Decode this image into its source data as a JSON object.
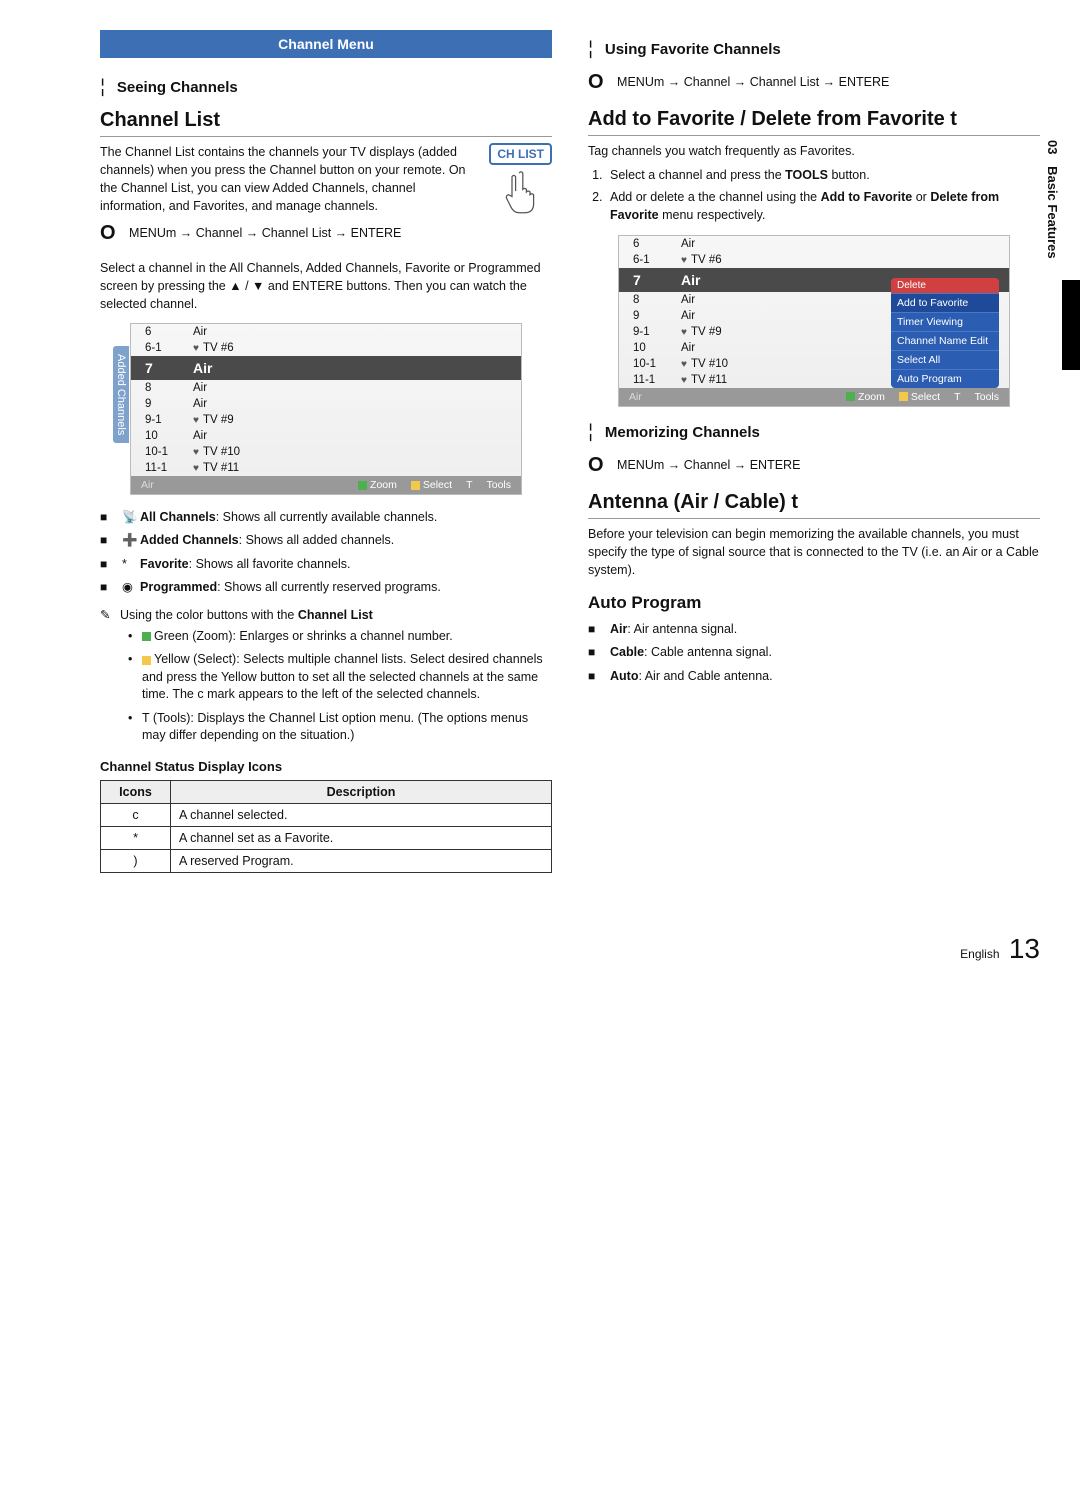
{
  "side": {
    "section_num": "03",
    "section_label": "Basic Features"
  },
  "left": {
    "header": "Channel Menu",
    "sub1_f": "¦",
    "sub1": "Seeing Channels",
    "h2": "Channel List",
    "chlist_label": "CH LIST",
    "intro": "The Channel List contains the channels your TV displays (added channels) when you press the Channel button on your remote. On the Channel List, you can view Added Channels, channel information, and Favorites, and manage channels.",
    "menu_O": "O",
    "menu_path": "MENUm  → Channel → Channel List → ENTERE",
    "select_text": "Select a channel in the All Channels, Added Channels, Favorite or Programmed screen by pressing the ▲ / ▼ and ENTERE  buttons. Then you can watch the selected channel.",
    "tv1": {
      "tab": "Added Channels",
      "rows": [
        {
          "ch": "6",
          "name": "Air",
          "heart": false
        },
        {
          "ch": "6-1",
          "name": "TV #6",
          "heart": true
        },
        {
          "ch": "7",
          "name": "Air",
          "sel": true
        },
        {
          "ch": "8",
          "name": "Air",
          "heart": false
        },
        {
          "ch": "9",
          "name": "Air",
          "heart": false
        },
        {
          "ch": "9-1",
          "name": "TV #9",
          "heart": true
        },
        {
          "ch": "10",
          "name": "Air",
          "heart": false
        },
        {
          "ch": "10-1",
          "name": "TV #10",
          "heart": true
        },
        {
          "ch": "11-1",
          "name": "TV #11",
          "heart": true
        }
      ],
      "footer_src": "Air",
      "footer_zoom": "Zoom",
      "footer_select": "Select",
      "footer_t": "T",
      "footer_tools": "Tools"
    },
    "bullets": [
      {
        "icon": "📡",
        "label": "All Channels",
        "desc": ": Shows all currently available channels."
      },
      {
        "icon": "➕",
        "label": "Added Channels",
        "desc": ": Shows all added channels."
      },
      {
        "icon": "*",
        "label": "Favorite",
        "desc": ": Shows all favorite channels."
      },
      {
        "icon": "◉",
        "label": "Programmed",
        "desc": ": Shows all currently reserved programs."
      }
    ],
    "note_pencil": "✎",
    "note": "Using the color buttons with the Channel List",
    "dots": [
      {
        "sq": "g",
        "label": "Green (Zoom)",
        "desc": ": Enlarges or shrinks a channel number."
      },
      {
        "sq": "y",
        "label": "Yellow (Select)",
        "desc": ": Selects multiple channel lists. Select desired channels and press the Yellow button to set all the selected channels at the same time. The c  mark appears to the left of the selected channels."
      },
      {
        "sq": "",
        "label": "T  (Tools)",
        "desc": ": Displays the Channel List option menu. (The options menus may differ depending on the situation.)"
      }
    ],
    "status_heading": "Channel Status Display Icons",
    "status_th_icons": "Icons",
    "status_th_desc": "Description",
    "status_rows": [
      {
        "icon": "c",
        "desc": "A channel selected."
      },
      {
        "icon": "*",
        "desc": "A channel set as a Favorite."
      },
      {
        "icon": ")",
        "desc": "A reserved Program."
      }
    ]
  },
  "right": {
    "sub1_f": "¦",
    "sub1": "Using Favorite Channels",
    "menu_O": "O",
    "menu_path1": "MENUm  → Channel → Channel List → ENTERE",
    "h2": "Add to Favorite / Delete from Favorite t",
    "tag_intro": "Tag channels you watch frequently as Favorites.",
    "steps": [
      "Select a channel and press the TOOLS button.",
      "Add or delete a the channel using the Add to Favorite or Delete from Favorite menu respectively."
    ],
    "tv2": {
      "rows": [
        {
          "ch": "6",
          "name": "Air",
          "heart": false
        },
        {
          "ch": "6-1",
          "name": "TV #6",
          "heart": true
        },
        {
          "ch": "7",
          "name": "Air",
          "sel": true
        },
        {
          "ch": "8",
          "name": "Air",
          "heart": false
        },
        {
          "ch": "9",
          "name": "Air",
          "heart": false
        },
        {
          "ch": "9-1",
          "name": "TV #9",
          "heart": true
        },
        {
          "ch": "10",
          "name": "Air",
          "heart": false
        },
        {
          "ch": "10-1",
          "name": "TV #10",
          "heart": true
        },
        {
          "ch": "11-1",
          "name": "TV #11",
          "heart": true
        }
      ],
      "ctx_hdr": "Delete",
      "ctx_items": [
        "Add to Favorite",
        "Timer Viewing",
        "Channel Name Edit",
        "Select All",
        "Auto Program"
      ],
      "footer_src": "Air",
      "footer_zoom": "Zoom",
      "footer_select": "Select",
      "footer_t": "T",
      "footer_tools": "Tools"
    },
    "sub2_f": "¦",
    "sub2": "Memorizing Channels",
    "menu_path2": "MENUm  → Channel → ENTERE",
    "h2b": "Antenna (Air / Cable) t",
    "antenna_text": "Before your television can begin memorizing the available channels, you must specify the type of signal source that is connected to the TV (i.e. an Air or a Cable system).",
    "h2c": "Auto Program",
    "auto_items": [
      {
        "label": "Air",
        "desc": ": Air antenna signal."
      },
      {
        "label": "Cable",
        "desc": ": Cable antenna signal."
      },
      {
        "label": "Auto",
        "desc": ": Air and Cable antenna."
      }
    ]
  },
  "pagenum_lang": "English",
  "pagenum_num": "13"
}
